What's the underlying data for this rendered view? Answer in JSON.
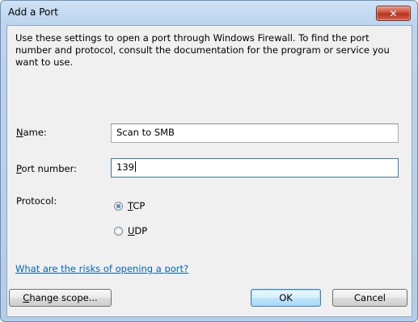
{
  "window": {
    "title": "Add a Port",
    "close_symbol": "✕"
  },
  "intro_text": "Use these settings to open a port through Windows Firewall. To find the port number and protocol, consult the documentation for the program or service you want to use.",
  "form": {
    "name_label_mnemonic": "N",
    "name_label_rest": "ame:",
    "name_value": "Scan to SMB",
    "port_label_mnemonic": "P",
    "port_label_rest": "ort number:",
    "port_value": "139",
    "protocol_label": "Protocol:",
    "protocols": [
      {
        "mnemonic": "T",
        "rest": "CP",
        "selected": true
      },
      {
        "mnemonic": "U",
        "rest": "DP",
        "selected": false
      }
    ]
  },
  "risks_link": "What are the risks of opening a port?",
  "buttons": {
    "change_scope_mnemonic": "C",
    "change_scope_rest": "hange scope...",
    "ok": "OK",
    "cancel": "Cancel"
  }
}
